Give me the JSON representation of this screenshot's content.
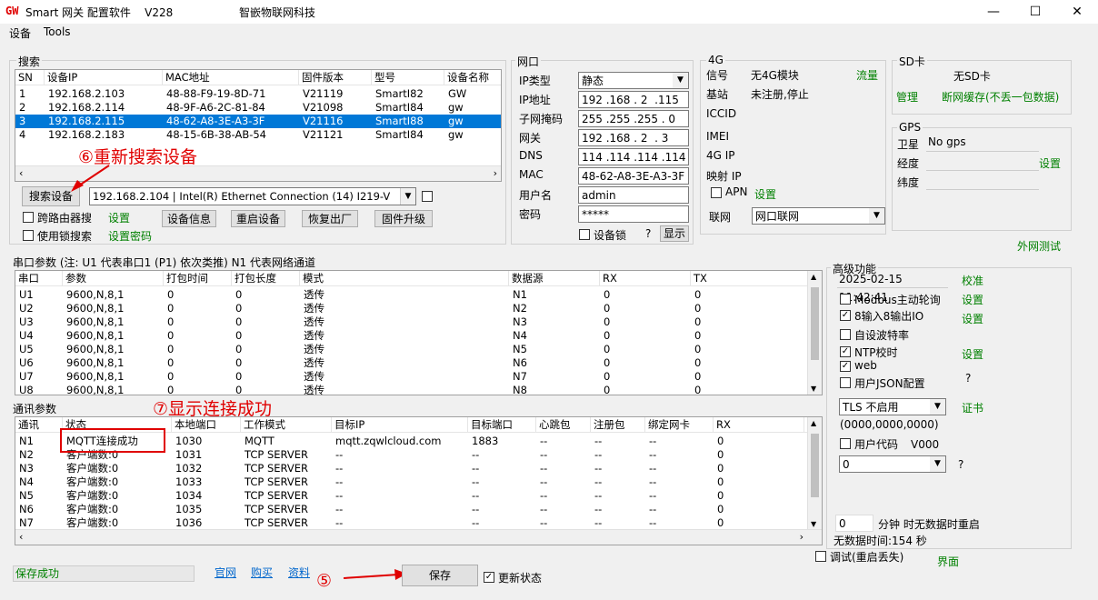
{
  "window": {
    "logo": "GW",
    "title": "Smart 网关 配置软件    V228",
    "company": "智嵌物联网科技",
    "minimize": "—",
    "maximize": "☐",
    "close": "✕"
  },
  "menu": [
    "设备",
    "Tools"
  ],
  "search": {
    "group_label": "搜索",
    "columns": [
      "SN",
      "设备IP",
      "MAC地址",
      "固件版本",
      "型号",
      "设备名称"
    ],
    "rows": [
      [
        "1",
        "192.168.2.103",
        "48-88-F9-19-8D-71",
        "V21119",
        "SmartI82",
        "GW"
      ],
      [
        "2",
        "192.168.2.114",
        "48-9F-A6-2C-81-84",
        "V21098",
        "SmartI84",
        "gw"
      ],
      [
        "3",
        "192.168.2.115",
        "48-62-A8-3E-A3-3F",
        "V21116",
        "SmartI88",
        "gw"
      ],
      [
        "4",
        "192.168.2.183",
        "48-15-6B-38-AB-54",
        "V21121",
        "SmartI84",
        "gw"
      ]
    ],
    "search_button": "搜索设备",
    "adapter": "192.168.2.104 | Intel(R) Ethernet Connection (14) I219-V",
    "cross_router": "跨路由器搜",
    "settings": "设置",
    "use_lock": "使用锁搜索",
    "set_password": "设置密码",
    "buttons": [
      "设备信息",
      "重启设备",
      "恢复出厂",
      "固件升级"
    ]
  },
  "annotations": {
    "a6": "⑥重新搜索设备",
    "a7": "⑦显示连接成功",
    "a5": "⑤"
  },
  "net": {
    "group_label": "网口",
    "ip_type_label": "IP类型",
    "ip_type": "静态",
    "ip_label": "IP地址",
    "ip": "192 .168 . 2  .115",
    "mask_label": "子网掩码",
    "mask": "255 .255 .255 . 0",
    "gateway_label": "网关",
    "gateway": "192 .168 . 2  . 3",
    "dns_label": "DNS",
    "dns": "114 .114 .114 .114",
    "mac_label": "MAC",
    "mac": "48-62-A8-3E-A3-3F",
    "user_label": "用户名",
    "user": "admin",
    "pwd_label": "密码",
    "pwd": "*****",
    "device_lock": "设备锁",
    "question": "?",
    "show": "显示"
  },
  "g4": {
    "group_label": "4G",
    "signal_label": "信号",
    "signal": "无4G模块",
    "traffic": "流量",
    "base_label": "基站",
    "base": "未注册,停止",
    "iccid": "ICCID",
    "imei": "IMEI",
    "ip4g": "4G IP",
    "map_ip": "映射 IP",
    "apn": "APN",
    "apn_set": "设置",
    "network_label": "联网",
    "network": "网口联网"
  },
  "sd": {
    "group_label": "SD卡",
    "status": "无SD卡",
    "manage": "管理",
    "cache": "断网缓存(不丢一包数据)"
  },
  "gps": {
    "group_label": "GPS",
    "sat_label": "卫星",
    "sat": "No gps",
    "lon_label": "经度",
    "set": "设置",
    "lat_label": "纬度"
  },
  "extnet": "外网测试",
  "serial": {
    "label": "串口参数  (注: U1 代表串口1 (P1) 依次类推) N1 代表网络通道",
    "columns": [
      "串口",
      "参数",
      "打包时间",
      "打包长度",
      "模式",
      "数据源",
      "RX",
      "TX"
    ],
    "rows": [
      [
        "U1",
        "9600,N,8,1",
        "0",
        "0",
        "透传",
        "N1",
        "0",
        "0"
      ],
      [
        "U2",
        "9600,N,8,1",
        "0",
        "0",
        "透传",
        "N2",
        "0",
        "0"
      ],
      [
        "U3",
        "9600,N,8,1",
        "0",
        "0",
        "透传",
        "N3",
        "0",
        "0"
      ],
      [
        "U4",
        "9600,N,8,1",
        "0",
        "0",
        "透传",
        "N4",
        "0",
        "0"
      ],
      [
        "U5",
        "9600,N,8,1",
        "0",
        "0",
        "透传",
        "N5",
        "0",
        "0"
      ],
      [
        "U6",
        "9600,N,8,1",
        "0",
        "0",
        "透传",
        "N6",
        "0",
        "0"
      ],
      [
        "U7",
        "9600,N,8,1",
        "0",
        "0",
        "透传",
        "N7",
        "0",
        "0"
      ],
      [
        "U8",
        "9600,N,8,1",
        "0",
        "0",
        "透传",
        "N8",
        "0",
        "0"
      ]
    ]
  },
  "comm": {
    "label": "通讯参数",
    "columns": [
      "通讯",
      "状态",
      "本地端口",
      "工作模式",
      "目标IP",
      "目标端口",
      "心跳包",
      "注册包",
      "绑定网卡",
      "RX"
    ],
    "rows": [
      [
        "N1",
        "MQTT连接成功",
        "1030",
        "MQTT",
        "mqtt.zqwlcloud.com",
        "1883",
        "--",
        "--",
        "--",
        "0"
      ],
      [
        "N2",
        "客户端数:0",
        "1031",
        "TCP SERVER",
        "--",
        "--",
        "--",
        "--",
        "--",
        "0"
      ],
      [
        "N3",
        "客户端数:0",
        "1032",
        "TCP SERVER",
        "--",
        "--",
        "--",
        "--",
        "--",
        "0"
      ],
      [
        "N4",
        "客户端数:0",
        "1033",
        "TCP SERVER",
        "--",
        "--",
        "--",
        "--",
        "--",
        "0"
      ],
      [
        "N5",
        "客户端数:0",
        "1034",
        "TCP SERVER",
        "--",
        "--",
        "--",
        "--",
        "--",
        "0"
      ],
      [
        "N6",
        "客户端数:0",
        "1035",
        "TCP SERVER",
        "--",
        "--",
        "--",
        "--",
        "--",
        "0"
      ],
      [
        "N7",
        "客户端数:0",
        "1036",
        "TCP SERVER",
        "--",
        "--",
        "--",
        "--",
        "--",
        "0"
      ]
    ]
  },
  "advanced": {
    "group_label": "高级功能",
    "datetime": "2025-02-15 11:42:41",
    "calibrate": "校准",
    "modbus": "Modbus主动轮询",
    "modbus_set": "设置",
    "io": "8输入8输出IO",
    "io_set": "设置",
    "baud": "自设波特率",
    "ntp": "NTP校时",
    "ntp_set": "设置",
    "web": "web",
    "json": "用户JSON配置",
    "q1": "?",
    "tls": "TLS 不启用",
    "cert": "证书",
    "tls_code": "(0000,0000,0000)",
    "user_code": "用户代码",
    "version": "V000",
    "code_val": "0",
    "q2": "?",
    "restart_min": "0",
    "restart_text": "分钟 时无数据时重启",
    "nodata": "无数据时间:154 秒",
    "debug": "调试(重启丢失)",
    "ui": "界面"
  },
  "footer": {
    "status": "保存成功",
    "official": "官网",
    "buy": "购买",
    "docs": "资料",
    "save": "保存",
    "update_status": "更新状态"
  }
}
